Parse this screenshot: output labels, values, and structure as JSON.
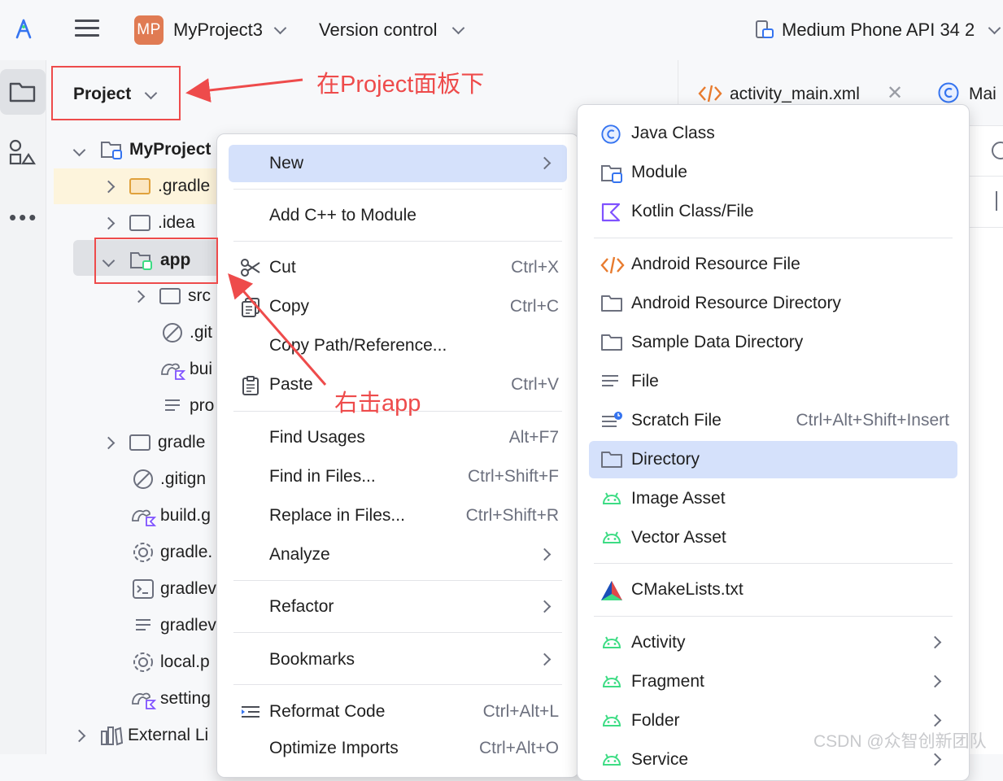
{
  "topbar": {
    "project_badge": "MP",
    "project_name": "MyProject3",
    "vcs": "Version control",
    "device": "Medium Phone API 34 2"
  },
  "panel": {
    "title": "Project"
  },
  "tree": [
    {
      "label": "MyProject",
      "bold": true
    },
    {
      "label": ".gradle"
    },
    {
      "label": ".idea"
    },
    {
      "label": "app",
      "bold": true
    },
    {
      "label": "src"
    },
    {
      "label": ".git"
    },
    {
      "label": "bui"
    },
    {
      "label": "pro"
    },
    {
      "label": "gradle"
    },
    {
      "label": ".gitign"
    },
    {
      "label": "build.g"
    },
    {
      "label": "gradle."
    },
    {
      "label": "gradlev"
    },
    {
      "label": "gradlev"
    },
    {
      "label": "local.p"
    },
    {
      "label": "setting"
    },
    {
      "label": "External Li"
    }
  ],
  "editor": {
    "tab1": "activity_main.xml",
    "tab2": "Mai"
  },
  "context_menu": [
    {
      "label": "New",
      "shortcut": "",
      "submenu": true,
      "selected": true
    },
    {
      "label": "Add C++ to Module",
      "shortcut": ""
    },
    {
      "label": "Cut",
      "shortcut": "Ctrl+X"
    },
    {
      "label": "Copy",
      "shortcut": "Ctrl+C"
    },
    {
      "label": "Copy Path/Reference...",
      "shortcut": ""
    },
    {
      "label": "Paste",
      "shortcut": "Ctrl+V"
    },
    {
      "label": "Find Usages",
      "shortcut": "Alt+F7"
    },
    {
      "label": "Find in Files...",
      "shortcut": "Ctrl+Shift+F"
    },
    {
      "label": "Replace in Files...",
      "shortcut": "Ctrl+Shift+R"
    },
    {
      "label": "Analyze",
      "shortcut": "",
      "submenu": true
    },
    {
      "label": "Refactor",
      "shortcut": "",
      "submenu": true
    },
    {
      "label": "Bookmarks",
      "shortcut": "",
      "submenu": true
    },
    {
      "label": "Reformat Code",
      "shortcut": "Ctrl+Alt+L"
    },
    {
      "label": "Optimize Imports",
      "shortcut": "Ctrl+Alt+O"
    }
  ],
  "new_submenu": [
    {
      "label": "Java Class",
      "icon": "java-class-icon"
    },
    {
      "label": "Module",
      "icon": "module-icon"
    },
    {
      "label": "Kotlin Class/File",
      "icon": "kotlin-icon"
    },
    {
      "label": "Android Resource File",
      "icon": "xml-code-icon"
    },
    {
      "label": "Android Resource Directory",
      "icon": "folder-icon"
    },
    {
      "label": "Sample Data Directory",
      "icon": "folder-icon"
    },
    {
      "label": "File",
      "icon": "text-file-icon"
    },
    {
      "label": "Scratch File",
      "icon": "scratch-file-icon",
      "shortcut": "Ctrl+Alt+Shift+Insert"
    },
    {
      "label": "Directory",
      "icon": "folder-icon",
      "selected": true
    },
    {
      "label": "Image Asset",
      "icon": "android-icon"
    },
    {
      "label": "Vector Asset",
      "icon": "android-icon"
    },
    {
      "label": "CMakeLists.txt",
      "icon": "cmake-icon"
    },
    {
      "label": "Activity",
      "icon": "android-icon",
      "submenu": true
    },
    {
      "label": "Fragment",
      "icon": "android-icon",
      "submenu": true
    },
    {
      "label": "Folder",
      "icon": "android-icon",
      "submenu": true
    },
    {
      "label": "Service",
      "icon": "android-icon",
      "submenu": true
    }
  ],
  "annotations": {
    "project_note": "在Project面板下",
    "app_note": "右击app"
  },
  "watermark": "CSDN @众智创新团队",
  "colors": {
    "accent": "#3574f0",
    "selection": "#d5e1fb",
    "annotation_red": "#ee4b4b",
    "android_green": "#3ddc84"
  }
}
